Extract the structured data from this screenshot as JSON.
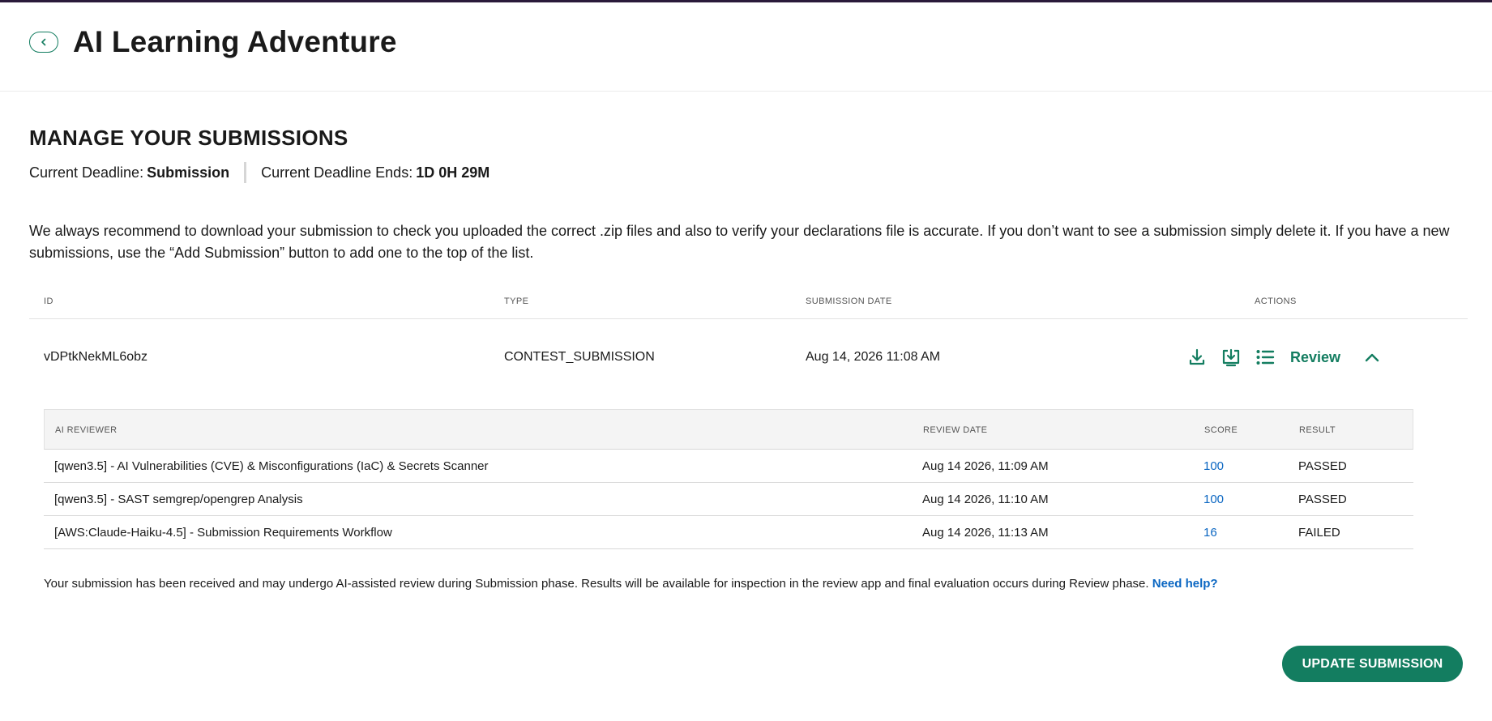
{
  "header": {
    "title": "AI Learning Adventure",
    "back_icon": "chevron-left-icon"
  },
  "section": {
    "title": "MANAGE YOUR SUBMISSIONS"
  },
  "deadline": {
    "label": "Current Deadline:",
    "value": "Submission",
    "ends_label": "Current Deadline Ends:",
    "ends_value": "1D 0H 29M"
  },
  "description": "We always recommend to download your submission to check you uploaded the correct .zip files and also to verify your declarations file is accurate. If you don’t want to see a submission simply delete it. If you have a new submissions, use the “Add Submission” button to add one  to the top of the list.",
  "submissions_table": {
    "columns": [
      "ID",
      "TYPE",
      "SUBMISSION DATE",
      "ACTIONS"
    ],
    "rows": [
      {
        "id": "vDPtkNekML6obz",
        "type": "CONTEST_SUBMISSION",
        "date": "Aug 14, 2026 11:08 AM",
        "actions": {
          "download_icon": "download-icon",
          "download_artifacts_icon": "download-tray-icon",
          "details_icon": "list-icon",
          "review_label": "Review",
          "collapse_icon": "chevron-up-icon"
        }
      }
    ]
  },
  "review_table": {
    "columns": [
      "AI REVIEWER",
      "REVIEW DATE",
      "SCORE",
      "RESULT"
    ],
    "rows": [
      {
        "reviewer": "[qwen3.5] - AI Vulnerabilities (CVE) & Misconfigurations (IaC) & Secrets Scanner",
        "date": "Aug 14 2026, 11:09 AM",
        "score": "100",
        "result": "PASSED"
      },
      {
        "reviewer": "[qwen3.5] - SAST semgrep/opengrep Analysis",
        "date": "Aug 14 2026, 11:10 AM",
        "score": "100",
        "result": "PASSED"
      },
      {
        "reviewer": "[AWS:Claude-Haiku-4.5] - Submission Requirements Workflow",
        "date": "Aug 14 2026, 11:13 AM",
        "score": "16",
        "result": "FAILED"
      }
    ]
  },
  "notice": {
    "text": "Your submission has been received and may undergo AI-assisted review during Submission phase. Results will be available for inspection in the review app and final evaluation occurs during Review phase.",
    "help_link": "Need help?"
  },
  "update_button": "UPDATE SUBMISSION",
  "colors": {
    "accent": "#137d60",
    "link": "#0a66c2"
  }
}
